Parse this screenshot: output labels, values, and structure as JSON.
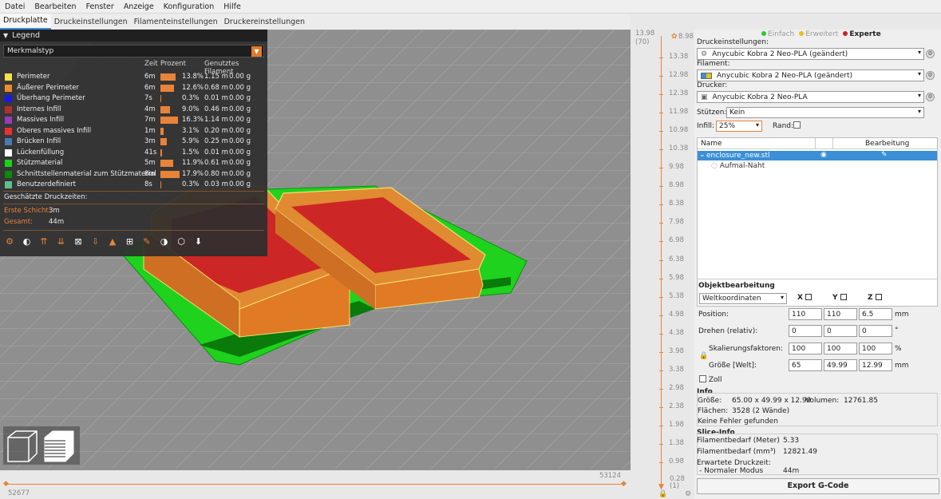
{
  "menu": [
    "Datei",
    "Bearbeiten",
    "Fenster",
    "Anzeige",
    "Konfiguration",
    "Hilfe"
  ],
  "tabs": [
    "Druckplatte",
    "Druckeinstellungen",
    "Filamenteinstellungen",
    "Druckereinstellungen"
  ],
  "legend": {
    "title": "Legend",
    "view_type": "Merkmalstyp",
    "col_time": "Zeit",
    "col_percent": "Prozent",
    "col_filament": "Genutztes Filament",
    "rows": [
      {
        "name": "Perimeter",
        "color": "#f2e14a",
        "time": "6m",
        "percent": "13.8%",
        "pct": 13.8,
        "meters": "1.15 m",
        "grams": "0.00 g"
      },
      {
        "name": "Äußerer Perimeter",
        "color": "#f08c2c",
        "time": "6m",
        "percent": "12.6%",
        "pct": 12.6,
        "meters": "0.68 m",
        "grams": "0.00 g"
      },
      {
        "name": "Überhang Perimeter",
        "color": "#1a1ae6",
        "time": "7s",
        "percent": "0.3%",
        "pct": 0.3,
        "meters": "0.01 m",
        "grams": "0.00 g"
      },
      {
        "name": "Internes Infill",
        "color": "#b03030",
        "time": "4m",
        "percent": "9.0%",
        "pct": 9.0,
        "meters": "0.46 m",
        "grams": "0.00 g"
      },
      {
        "name": "Massives Infill",
        "color": "#9a3ab8",
        "time": "7m",
        "percent": "16.3%",
        "pct": 16.3,
        "meters": "1.14 m",
        "grams": "0.00 g"
      },
      {
        "name": "Oberes massives Infill",
        "color": "#e63232",
        "time": "1m",
        "percent": "3.1%",
        "pct": 3.1,
        "meters": "0.20 m",
        "grams": "0.00 g"
      },
      {
        "name": "Brücken Infill",
        "color": "#4a78b0",
        "time": "3m",
        "percent": "5.9%",
        "pct": 5.9,
        "meters": "0.25 m",
        "grams": "0.00 g"
      },
      {
        "name": "Lückenfüllung",
        "color": "#ffffff",
        "time": "41s",
        "percent": "1.5%",
        "pct": 1.5,
        "meters": "0.01 m",
        "grams": "0.00 g"
      },
      {
        "name": "Stützmaterial",
        "color": "#19d219",
        "time": "5m",
        "percent": "11.9%",
        "pct": 11.9,
        "meters": "0.61 m",
        "grams": "0.00 g"
      },
      {
        "name": "Schnittstellenmaterial zum Stützmaterial",
        "color": "#0a8a0a",
        "time": "8m",
        "percent": "17.9%",
        "pct": 17.9,
        "meters": "0.80 m",
        "grams": "0.00 g"
      },
      {
        "name": "Benutzerdefiniert",
        "color": "#5ebf8e",
        "time": "8s",
        "percent": "0.3%",
        "pct": 0.3,
        "meters": "0.03 m",
        "grams": "0.00 g"
      }
    ],
    "estimated_label": "Geschätzte Druckzeiten:",
    "first_layer_label": "Erste Schicht:",
    "first_layer_value": "3m",
    "total_label": "Gesamt:",
    "total_value": "44m"
  },
  "h_slider": {
    "right_value": "53124",
    "left_value": "52677"
  },
  "v_slider": {
    "top_value": "13.98",
    "top_layer": "(70)",
    "top_right": "8.98",
    "ticks": [
      "13.38",
      "12.98",
      "12.38",
      "11.98",
      "10.98",
      "10.38",
      "9.98",
      "8.98",
      "8.38",
      "7.98",
      "6.98",
      "6.38",
      "5.98",
      "5.38",
      "4.98",
      "4.38",
      "3.98",
      "3.38",
      "2.98",
      "2.38",
      "1.98",
      "1.38",
      "0.98"
    ],
    "bottom_value": "0.28",
    "bottom_layer": "(1)"
  },
  "panel": {
    "modes": [
      {
        "label": "Einfach",
        "color": "#32c832",
        "active": false
      },
      {
        "label": "Erweitert",
        "color": "#e8c020",
        "active": false
      },
      {
        "label": "Experte",
        "color": "#d02020",
        "active": true
      }
    ],
    "print_settings_label": "Druckeinstellungen:",
    "print_settings_value": "Anycubic Kobra 2 Neo-PLA (geändert)",
    "filament_label": "Filament:",
    "filament_value": "Anycubic Kobra 2 Neo-PLA (geändert)",
    "printer_label": "Drucker:",
    "printer_value": "Anycubic Kobra 2 Neo-PLA",
    "supports_label": "Stützen:",
    "supports_value": "Kein",
    "infill_label": "Infill:",
    "infill_value": "25%",
    "brim_label": "Rand:",
    "tree": {
      "col_name": "Name",
      "col_edit": "Bearbeitung",
      "object_name": "enclosure_new.stl",
      "child_name": "Aufmal-Naht"
    },
    "object_edit": {
      "title": "Objektbearbeitung",
      "coords": "Weltkoordinaten",
      "x_label": "X",
      "y_label": "Y",
      "z_label": "Z",
      "position_label": "Position:",
      "position": [
        "110",
        "110",
        "6.5"
      ],
      "position_unit": "mm",
      "rotate_label": "Drehen (relativ):",
      "rotate": [
        "0",
        "0",
        "0"
      ],
      "rotate_unit": "°",
      "scale_label": "Skalierungsfaktoren:",
      "scale": [
        "100",
        "100",
        "100"
      ],
      "scale_unit": "%",
      "size_label": "Größe [Welt]:",
      "size": [
        "65",
        "49.99",
        "12.99"
      ],
      "size_unit": "mm",
      "inch_label": "Zoll"
    },
    "info": {
      "title": "Info",
      "size_label": "Größe:",
      "size_value": "65.00 x 49.99 x 12.99",
      "volume_label": "Volumen:",
      "volume_value": "12761.85",
      "facets_label": "Flächen:",
      "facets_value": "3528 (2 Wände)",
      "errors": "Keine Fehler gefunden"
    },
    "slice_info": {
      "title": "Slice-Info",
      "fil_m_label": "Filamentbedarf (Meter)",
      "fil_m_value": "5.33",
      "fil_mm3_label": "Filamentbedarf (mm³)",
      "fil_mm3_value": "12821.49",
      "time_label": "Erwartete Druckzeit:",
      "mode_label": "- Normaler Modus",
      "mode_value": "44m"
    },
    "export_label": "Export G-Code"
  },
  "colors": {
    "accent": "#e8833a",
    "selection": "#3a8fd6",
    "support": "#19d219",
    "top_infill": "#e63232"
  }
}
